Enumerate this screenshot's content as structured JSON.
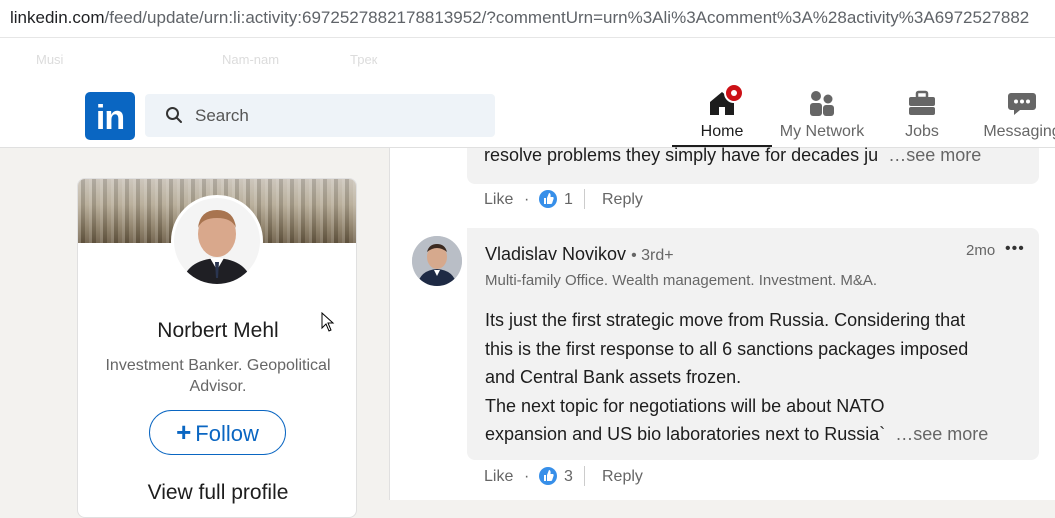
{
  "browser": {
    "url_domain": "linkedin.com",
    "url_path": "/feed/update/urn:li:activity:6972527882178813952/?commentUrn=urn%3Ali%3Acomment%3A%28activity%3A6972527882",
    "bookmarks": [
      "Musi",
      "Nam-nam",
      "Трек",
      "",
      "",
      ""
    ]
  },
  "nav": {
    "logo": "in",
    "search_placeholder": "Search",
    "items": [
      {
        "label": "Home",
        "icon": "home-icon",
        "active": true
      },
      {
        "label": "My Network",
        "icon": "network-icon"
      },
      {
        "label": "Jobs",
        "icon": "briefcase-icon"
      },
      {
        "label": "Messaging",
        "icon": "messaging-icon"
      }
    ]
  },
  "profile_card": {
    "name": "Norbert Mehl",
    "headline": "Investment Banker. Geopolitical Advisor.",
    "follow_plus": "+",
    "follow_label": "Follow",
    "view_profile": "View full profile"
  },
  "comment1": {
    "text": "resolve problems they simply have for decades ju",
    "see_more": "…see more",
    "like_label": "Like",
    "dot": "·",
    "reactions": "1",
    "reply_label": "Reply"
  },
  "comment2": {
    "name": "Vladislav Novikov",
    "degree": "• 3rd+",
    "time": "2mo",
    "more": "•••",
    "headline": "Multi-family Office. Wealth management. Investment. M&A.",
    "body_lines": [
      "Its just the first strategic move from Russia. Considering that",
      "this is the first response to all 6 sanctions packages imposed",
      "and Central Bank assets frozen.",
      "The next topic for negotiations will be about NATO"
    ],
    "last_line": "expansion and US bio laboratories next to Russia`",
    "see_more": "…see more",
    "like_label": "Like",
    "dot": "·",
    "reactions": "3",
    "reply_label": "Reply"
  },
  "colors": {
    "linkedin_blue": "#0a66c2",
    "notification_red": "#cc1016",
    "page_bg": "#f3f2ef"
  }
}
